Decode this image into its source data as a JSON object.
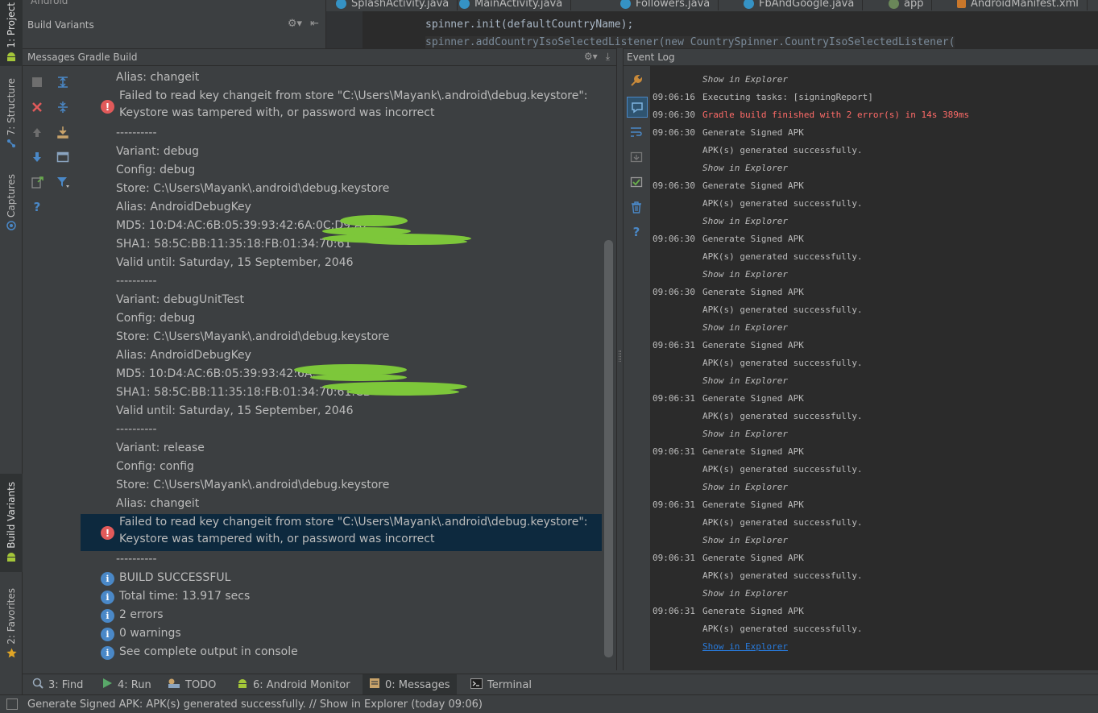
{
  "left_strip": {
    "project_label": "1: Project",
    "structure_label": "7: Structure",
    "captures_label": "Captures",
    "build_variants_label": "Build Variants",
    "favorites_label": "2: Favorites"
  },
  "build_variants": {
    "title": "Build Variants",
    "top_value": "Android"
  },
  "editor": {
    "tabs": [
      {
        "label": "SplashActivity.java"
      },
      {
        "label": "MainActivity.java"
      },
      {
        "label": "Followers.java"
      },
      {
        "label": "FbAndGoogle.java"
      },
      {
        "label": "app"
      },
      {
        "label": "AndroidManifest.xml"
      }
    ],
    "code_lines": [
      "spinner.init(defaultCountryName);",
      "spinner.addCountryIsoSelectedListener(new CountrySpinner.CountryIsoSelectedListener("
    ]
  },
  "messages": {
    "title": "Messages Gradle Build",
    "lines": [
      {
        "text": "Alias: changeit",
        "kind": "plain"
      },
      {
        "text": "Failed to read key changeit from store \"C:\\Users\\Mayank\\.android\\debug.keystore\":",
        "kind": "error"
      },
      {
        "text": "Keystore was tampered with, or password was incorrect",
        "kind": "cont"
      },
      {
        "text": "----------",
        "kind": "plain"
      },
      {
        "text": "Variant: debug",
        "kind": "plain"
      },
      {
        "text": "Config: debug",
        "kind": "plain"
      },
      {
        "text": "Store: C:\\Users\\Mayank\\.android\\debug.keystore",
        "kind": "plain"
      },
      {
        "text": "Alias: AndroidDebugKey",
        "kind": "plain"
      },
      {
        "text": "MD5: 10:D4:AC:6B:05:39:93:42:6A:0C:D9:A2",
        "kind": "plain"
      },
      {
        "text": "SHA1: 58:5C:BB:11:35:18:FB:01:34:70:61",
        "kind": "plain"
      },
      {
        "text": "Valid until: Saturday, 15 September, 2046",
        "kind": "plain"
      },
      {
        "text": "----------",
        "kind": "plain"
      },
      {
        "text": "Variant: debugUnitTest",
        "kind": "plain"
      },
      {
        "text": "Config: debug",
        "kind": "plain"
      },
      {
        "text": "Store: C:\\Users\\Mayank\\.android\\debug.keystore",
        "kind": "plain"
      },
      {
        "text": "Alias: AndroidDebugKey",
        "kind": "plain"
      },
      {
        "text": "MD5: 10:D4:AC:6B:05:39:93:42:6A:",
        "kind": "plain"
      },
      {
        "text": "SHA1: 58:5C:BB:11:35:18:FB:01:34:70:61:CD",
        "kind": "plain"
      },
      {
        "text": "Valid until: Saturday, 15 September, 2046",
        "kind": "plain"
      },
      {
        "text": "----------",
        "kind": "plain"
      },
      {
        "text": "Variant: release",
        "kind": "plain"
      },
      {
        "text": "Config: config",
        "kind": "plain"
      },
      {
        "text": "Store: C:\\Users\\Mayank\\.android\\debug.keystore",
        "kind": "plain"
      },
      {
        "text": "Alias: changeit",
        "kind": "plain"
      },
      {
        "text": "Failed to read key changeit from store \"C:\\Users\\Mayank\\.android\\debug.keystore\":",
        "kind": "error",
        "selected": true
      },
      {
        "text": "Keystore was tampered with, or password was incorrect",
        "kind": "cont",
        "selected": true
      },
      {
        "text": "----------",
        "kind": "plain"
      },
      {
        "text": "BUILD SUCCESSFUL",
        "kind": "info"
      },
      {
        "text": "Total time: 13.917 secs",
        "kind": "info"
      },
      {
        "text": "2 errors",
        "kind": "info"
      },
      {
        "text": "0 warnings",
        "kind": "info"
      },
      {
        "text": "See complete output in console",
        "kind": "info"
      }
    ]
  },
  "event_log": {
    "title": "Event Log",
    "entries": [
      {
        "time": "",
        "text": "Show in Explorer",
        "kind": "link"
      },
      {
        "time": "09:06:16",
        "text": "Executing tasks: [signingReport]",
        "kind": "plain"
      },
      {
        "time": "09:06:30",
        "text": "Gradle build finished with 2 error(s) in 14s 389ms",
        "kind": "error"
      },
      {
        "time": "09:06:30",
        "text": "Generate Signed APK",
        "kind": "plain"
      },
      {
        "time": "",
        "text": "APK(s) generated successfully.",
        "kind": "plain"
      },
      {
        "time": "",
        "text": "Show in Explorer",
        "kind": "link"
      },
      {
        "time": "09:06:30",
        "text": "Generate Signed APK",
        "kind": "plain"
      },
      {
        "time": "",
        "text": "APK(s) generated successfully.",
        "kind": "plain"
      },
      {
        "time": "",
        "text": "Show in Explorer",
        "kind": "link"
      },
      {
        "time": "09:06:30",
        "text": "Generate Signed APK",
        "kind": "plain"
      },
      {
        "time": "",
        "text": "APK(s) generated successfully.",
        "kind": "plain"
      },
      {
        "time": "",
        "text": "Show in Explorer",
        "kind": "link"
      },
      {
        "time": "09:06:30",
        "text": "Generate Signed APK",
        "kind": "plain"
      },
      {
        "time": "",
        "text": "APK(s) generated successfully.",
        "kind": "plain"
      },
      {
        "time": "",
        "text": "Show in Explorer",
        "kind": "link"
      },
      {
        "time": "09:06:31",
        "text": "Generate Signed APK",
        "kind": "plain"
      },
      {
        "time": "",
        "text": "APK(s) generated successfully.",
        "kind": "plain"
      },
      {
        "time": "",
        "text": "Show in Explorer",
        "kind": "link"
      },
      {
        "time": "09:06:31",
        "text": "Generate Signed APK",
        "kind": "plain"
      },
      {
        "time": "",
        "text": "APK(s) generated successfully.",
        "kind": "plain"
      },
      {
        "time": "",
        "text": "Show in Explorer",
        "kind": "link"
      },
      {
        "time": "09:06:31",
        "text": "Generate Signed APK",
        "kind": "plain"
      },
      {
        "time": "",
        "text": "APK(s) generated successfully.",
        "kind": "plain"
      },
      {
        "time": "",
        "text": "Show in Explorer",
        "kind": "link"
      },
      {
        "time": "09:06:31",
        "text": "Generate Signed APK",
        "kind": "plain"
      },
      {
        "time": "",
        "text": "APK(s) generated successfully.",
        "kind": "plain"
      },
      {
        "time": "",
        "text": "Show in Explorer",
        "kind": "link"
      },
      {
        "time": "09:06:31",
        "text": "Generate Signed APK",
        "kind": "plain"
      },
      {
        "time": "",
        "text": "APK(s) generated successfully.",
        "kind": "plain"
      },
      {
        "time": "",
        "text": "Show in Explorer",
        "kind": "link"
      },
      {
        "time": "09:06:31",
        "text": "Generate Signed APK",
        "kind": "plain"
      },
      {
        "time": "",
        "text": "APK(s) generated successfully.",
        "kind": "plain"
      },
      {
        "time": "",
        "text": "Show in Explorer",
        "kind": "hyperlink"
      }
    ]
  },
  "bottom_tabs": [
    {
      "label": "3: Find",
      "icon": "search-icon",
      "active": false
    },
    {
      "label": "4: Run",
      "icon": "run-icon",
      "active": false
    },
    {
      "label": "TODO",
      "icon": "todo-icon",
      "active": false
    },
    {
      "label": "6: Android Monitor",
      "icon": "android-icon",
      "active": false
    },
    {
      "label": "0: Messages",
      "icon": "messages-icon",
      "active": true
    },
    {
      "label": "Terminal",
      "icon": "terminal-icon",
      "active": false
    }
  ],
  "status_bar": {
    "text": "Generate Signed APK: APK(s) generated successfully. // Show in Explorer (today 09:06)"
  },
  "colors": {
    "panel_bg": "#3c3f41",
    "editor_bg": "#2b2b2b",
    "error_red": "#ff6b68",
    "link_blue": "#287bde",
    "selection": "#0d293e",
    "info_blue": "#4a88c7",
    "error_badge": "#e15a5a"
  }
}
